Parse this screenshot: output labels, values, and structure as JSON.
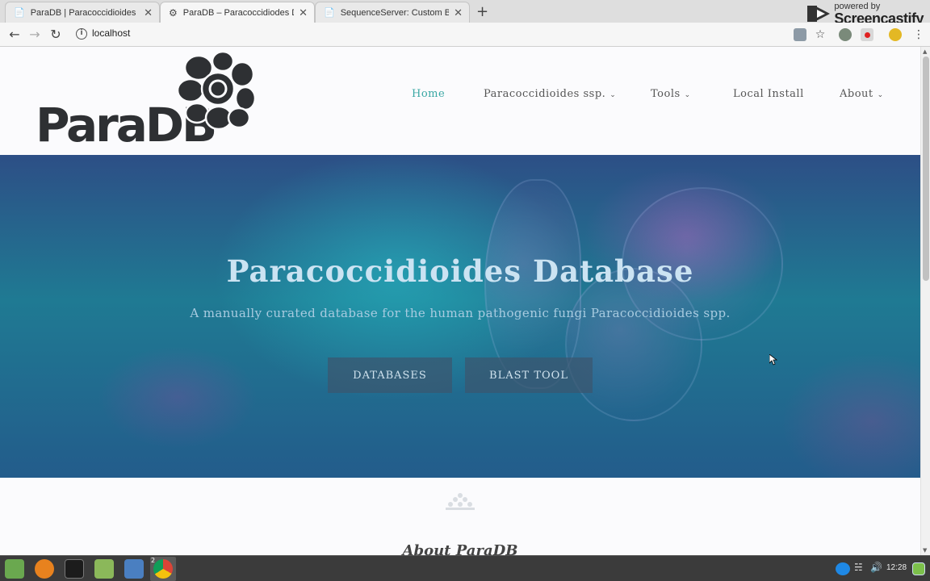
{
  "browser": {
    "tabs": [
      {
        "title": "ParaDB | Paracoccidioides Dat",
        "active": false
      },
      {
        "title": "ParaDB – Paracoccidiodes Dat",
        "active": true
      },
      {
        "title": "SequenceServer: Custom BLAS",
        "active": false
      }
    ],
    "url": "localhost",
    "screencastify": {
      "line1": "powered by",
      "line2": "Screencastify"
    }
  },
  "site": {
    "logo_text": "ParaDB",
    "nav": [
      {
        "label": "Home",
        "active": true,
        "dropdown": false
      },
      {
        "label": "Paracoccidioides ssp.",
        "active": false,
        "dropdown": true
      },
      {
        "label": "Tools",
        "active": false,
        "dropdown": true
      },
      {
        "label": "Local Install",
        "active": false,
        "dropdown": false
      },
      {
        "label": "About",
        "active": false,
        "dropdown": true
      }
    ],
    "hero": {
      "title": "Paracoccidioides Database",
      "subtitle": "A manually curated database for the human pathogenic fungi Paracoccidioides spp.",
      "buttons": [
        "DATABASES",
        "BLAST TOOL"
      ]
    },
    "about_title": "About ParaDB"
  },
  "taskbar": {
    "clock": "12:28",
    "workspace_badge": "2"
  },
  "colors": {
    "accent": "#3aa7a4",
    "logo": "#2e3033"
  }
}
